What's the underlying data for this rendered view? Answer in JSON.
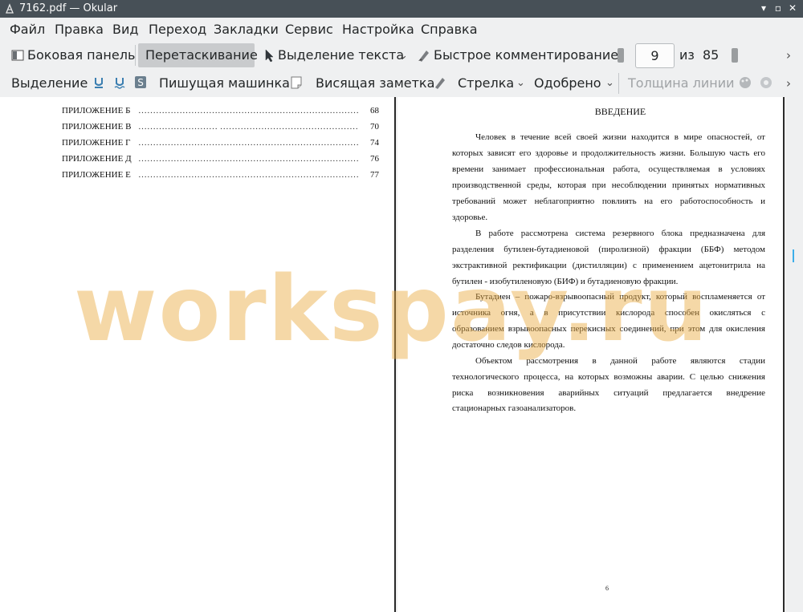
{
  "window": {
    "title": "7162.pdf  — Okular"
  },
  "menu": [
    "Файл",
    "Правка",
    "Вид",
    "Переход",
    "Закладки",
    "Сервис",
    "Настройка",
    "Справка"
  ],
  "toolbar1": {
    "sidebar": "Боковая панель",
    "drag": "Перетаскивание",
    "text_select": "Выделение текста",
    "quick_comment": "Быстрое комментирование",
    "page_current": "9",
    "page_of": "из",
    "page_total": "85"
  },
  "toolbar2": {
    "select": "Выделение",
    "typewriter": "Пишущая машинка",
    "pinned_note": "Висящая заметка",
    "arrow": "Стрелка",
    "stamp": "Одобрено",
    "line_width": "Толщина линии"
  },
  "left_page": {
    "toc": [
      {
        "label": "ПРИЛОЖЕНИЕ Б",
        "page": "68"
      },
      {
        "label": "ПРИЛОЖЕНИЕ В",
        "page": "70"
      },
      {
        "label": "ПРИЛОЖЕНИЕ Г",
        "page": "74"
      },
      {
        "label": "ПРИЛОЖЕНИЕ Д",
        "page": "76"
      },
      {
        "label": "ПРИЛОЖЕНИЕ Е",
        "page": "77"
      }
    ]
  },
  "right_page": {
    "heading": "ВВЕДЕНИЕ",
    "lines": [
      "Человек в течение всей своей жизни находится в мире опасностей, от",
      "которых зависят его здоровье и продолжительность жизни. Большую часть его",
      "времени занимает профессиональная работа, осуществляемая в условиях",
      "производственной среды, которая при несоблюдении принятых нормативных",
      "требований может неблагоприятно повлиять на его работоспособность и",
      "здоровье.",
      "В работе рассмотрена система резервного блока предназначена для",
      "разделения бутилен-бутадиеновой (пиролизной) фракции (ББФ) методом",
      "экстрактивной ректификации (дистилляции) с применением ацетонитрила на",
      "бутилен - изобутиленовую (БИФ) и бутадиеновую фракции.",
      "Бутадиен – пожаро-взрывоопасный продукт, который воспламеняется от",
      "источника огня, а в присутствии кислорода способен окисляться с",
      "образованием взрывоопасных перекисных соединений, при этом для окисления",
      "достаточно следов кислорода.",
      "Объектом рассмотрения в данной работе являются стадии",
      "технологического процесса, на которых возможны аварии. С целью снижения",
      "риска возникновения аварийных ситуаций предлагается внедрение",
      "стационарных газоанализаторов."
    ],
    "page_number": "6"
  },
  "watermark": "workspay.ru"
}
